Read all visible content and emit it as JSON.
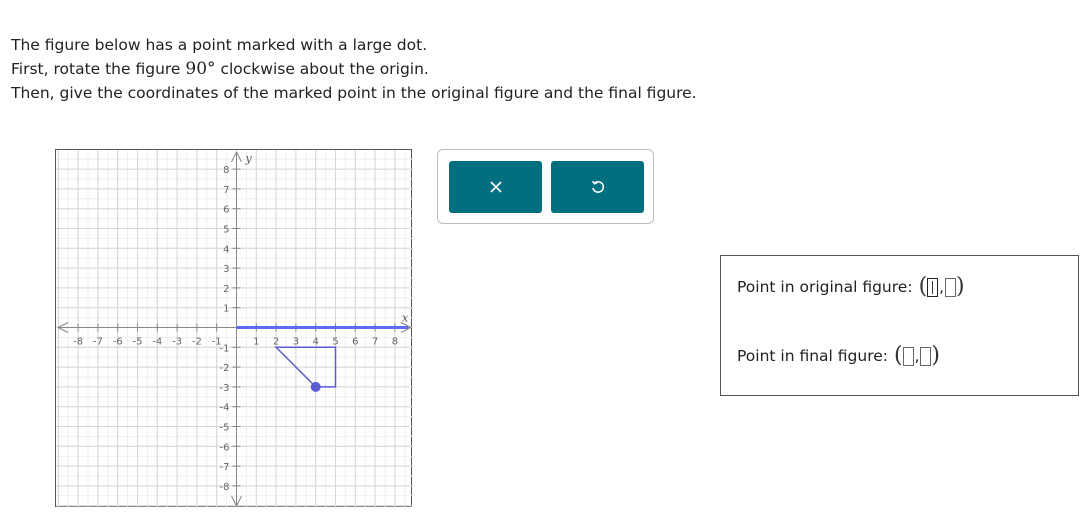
{
  "instructions": {
    "line1": "The figure below has a point marked with a large dot.",
    "line2_pre": "First, rotate the figure ",
    "line2_deg": "90°",
    "line2_post": " clockwise about the origin.",
    "line3": "Then, give the coordinates of the marked point in the original figure and the final figure."
  },
  "graph": {
    "x_axis_label": "x",
    "y_axis_label": "y",
    "x_range": [
      -8,
      8
    ],
    "y_range": [
      -8,
      8
    ],
    "x_tick_labels": [
      "-8",
      "-7",
      "-6",
      "-5",
      "-4",
      "-3",
      "-2",
      "-1",
      "1",
      "2",
      "3",
      "4",
      "5",
      "6",
      "7",
      "8"
    ],
    "y_tick_labels": [
      "8",
      "7",
      "6",
      "5",
      "4",
      "3",
      "2",
      "1",
      "-1",
      "-2",
      "-3",
      "-4",
      "-5",
      "-6",
      "-7",
      "-8"
    ],
    "figure_vertices": [
      [
        2,
        -1
      ],
      [
        5,
        -1
      ],
      [
        5,
        -3
      ],
      [
        4,
        -3
      ]
    ],
    "marked_point": [
      4,
      -3
    ],
    "figure_color": "#5b5bd6",
    "highlight_axis_color": "#5b6cf0"
  },
  "tools": {
    "clear_icon": "x-icon",
    "reset_icon": "undo-icon",
    "button_color": "#006f7f"
  },
  "answers": {
    "original_label": "Point in original figure:",
    "final_label": "Point in final figure:",
    "comma": ","
  }
}
